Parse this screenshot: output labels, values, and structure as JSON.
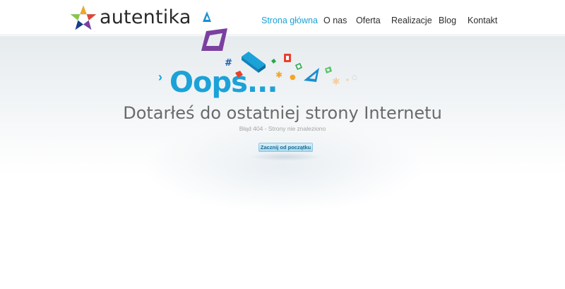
{
  "header": {
    "brand_name": "autentika",
    "nav": [
      {
        "label": "Strona główna",
        "active": true
      },
      {
        "label": "O nas",
        "active": false
      },
      {
        "label": "Oferta",
        "active": false
      },
      {
        "label": "Realizacje",
        "active": false
      },
      {
        "label": "Blog",
        "active": false
      },
      {
        "label": "Kontakt",
        "active": false
      }
    ]
  },
  "error": {
    "heading": "Oops...",
    "subtitle": "Dotarłeś do ostatniej strony Internetu",
    "detail": "Błąd 404 - Strony nie znaleziono",
    "button_label": "Zacznij od początku"
  },
  "colors": {
    "accent": "#1ba2d8",
    "text": "#2d2d2d"
  }
}
